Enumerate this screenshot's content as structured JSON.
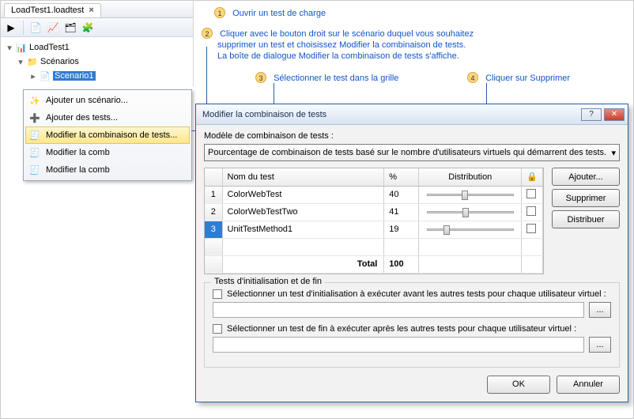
{
  "tab": {
    "title": "LoadTest1.loadtest"
  },
  "tree": {
    "root": "LoadTest1",
    "scenarios_label": "Scénarios",
    "scenario": "Scenario1"
  },
  "context_menu": {
    "items": [
      {
        "label": "Ajouter un scénario..."
      },
      {
        "label": "Ajouter des tests..."
      },
      {
        "label": "Modifier la combinaison de tests..."
      },
      {
        "label": "Modifier la comb"
      },
      {
        "label": "Modifier la comb"
      }
    ]
  },
  "callouts": {
    "c1": "Ouvrir un test de charge",
    "c2a": "Cliquer avec le bouton droit sur le scénario duquel vous souhaitez",
    "c2b": "supprimer un test et choisissez Modifier la combinaison de tests.",
    "c2c": "La boîte de dialogue Modifier la combinaison de tests s'affiche.",
    "c3": "Sélectionner le test dans la grille",
    "c4": "Cliquer sur Supprimer"
  },
  "dialog": {
    "title": "Modifier la combinaison de tests",
    "model_label": "Modèle de combinaison de tests :",
    "model_value": "Pourcentage de combinaison de tests basé sur le nombre d'utilisateurs virtuels qui démarrent des tests.",
    "headers": {
      "name": "Nom du test",
      "pct": "%",
      "dist": "Distribution",
      "lock_icon": "🔒"
    },
    "rows": [
      {
        "n": "1",
        "name": "ColorWebTest",
        "pct": "40",
        "pos": 40
      },
      {
        "n": "2",
        "name": "ColorWebTestTwo",
        "pct": "41",
        "pos": 41
      },
      {
        "n": "3",
        "name": "UnitTestMethod1",
        "pct": "19",
        "pos": 19
      }
    ],
    "total_label": "Total",
    "total_value": "100",
    "buttons": {
      "add": "Ajouter...",
      "remove": "Supprimer",
      "distribute": "Distribuer"
    },
    "group_title": "Tests d'initialisation et de fin",
    "init_label": "Sélectionner un test d'initialisation à exécuter avant les autres tests pour chaque utilisateur virtuel :",
    "end_label": "Sélectionner un test de fin à exécuter après les autres tests pour chaque utilisateur virtuel :",
    "ok": "OK",
    "cancel": "Annuler",
    "browse": "..."
  }
}
